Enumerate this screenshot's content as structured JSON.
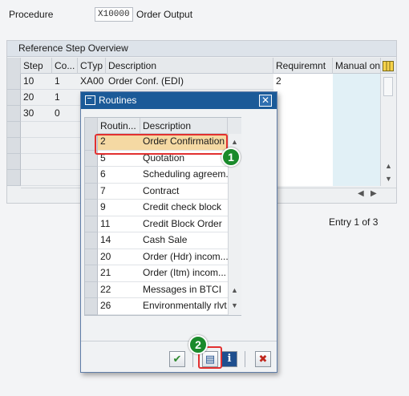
{
  "procedure": {
    "label": "Procedure",
    "code": "X10000",
    "description": "Order Output"
  },
  "overview": {
    "title": "Reference Step Overview",
    "columns": [
      "Step",
      "Co...",
      "CTyp",
      "Description",
      "Requiremnt",
      "Manual only"
    ],
    "rows": [
      {
        "step": "10",
        "counter": "1",
        "ctyp": "XA00",
        "description": "Order Conf. (EDI)",
        "requirement": "2"
      },
      {
        "step": "20",
        "counter": "1",
        "ctyp": "",
        "description": "",
        "requirement": ""
      },
      {
        "step": "30",
        "counter": "0",
        "ctyp": "",
        "description": "",
        "requirement": ""
      }
    ],
    "entry_text": "Entry 1 of 3"
  },
  "dialog": {
    "title": "Routines",
    "close_icon": "close-icon",
    "columns": [
      "Routin...",
      "Description"
    ],
    "rows": [
      {
        "routine": "2",
        "description": "Order Confirmation"
      },
      {
        "routine": "5",
        "description": "Quotation"
      },
      {
        "routine": "6",
        "description": "Scheduling agreem..."
      },
      {
        "routine": "7",
        "description": "Contract"
      },
      {
        "routine": "9",
        "description": "Credit check block"
      },
      {
        "routine": "11",
        "description": "Credit Block Order"
      },
      {
        "routine": "14",
        "description": "Cash Sale"
      },
      {
        "routine": "20",
        "description": "Order (Hdr) incom..."
      },
      {
        "routine": "21",
        "description": "Order (Itm) incom..."
      },
      {
        "routine": "22",
        "description": "Messages in BTCI"
      },
      {
        "routine": "26",
        "description": "Environmentally rlvt"
      }
    ],
    "buttons": [
      {
        "name": "confirm-button",
        "glyph": "✔",
        "color": "#2f8a2f"
      },
      {
        "name": "source-code-button",
        "glyph": "▤",
        "color": "#1f4f8f"
      },
      {
        "name": "info-button",
        "glyph": "i",
        "color": "#ffffff"
      },
      {
        "name": "cancel-button",
        "glyph": "✖",
        "color": "#c0281e"
      }
    ]
  },
  "annotations": {
    "step1": "1",
    "step2": "2",
    "highlight_color": "#e23030",
    "badge_color": "#1a8a2b"
  }
}
